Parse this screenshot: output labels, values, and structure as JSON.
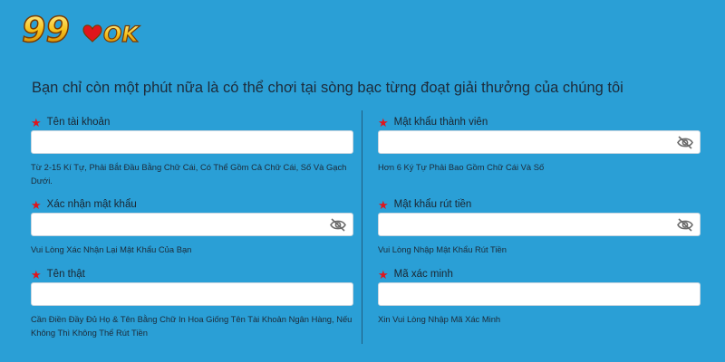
{
  "logo": {
    "text": "99OK"
  },
  "headline": "Bạn chỉ còn một phút nữa là có thể chơi tại sòng bạc từng đoạt giải thưởng của chúng tôi",
  "colors": {
    "background": "#2a9fd6",
    "required_star": "#e0151c",
    "input_bg": "#ffffff"
  },
  "form": {
    "left": [
      {
        "label": "Tên tài khoản",
        "value": "",
        "hint": "Từ 2-15 Kí Tự, Phải Bắt Đầu Bằng Chữ Cái, Có Thể Gồm Cả Chữ Cái, Số Và Gạch Dưới."
      },
      {
        "label": "Xác nhận mật khẩu",
        "value": "",
        "hint": "Vui Lòng Xác Nhận Lại Mật Khẩu Của Bạn",
        "icon": "eye-slash-icon"
      },
      {
        "label": "Tên thật",
        "value": "",
        "hint": "Cần Điền Đầy Đủ Họ & Tên Bằng Chữ In Hoa Giống Tên Tài Khoản Ngân Hàng, Nếu Không Thì Không Thể Rút Tiền"
      }
    ],
    "right": [
      {
        "label": "Mật khẩu thành viên",
        "value": "",
        "hint": "Hơn 6 Ký Tự Phải Bao Gồm Chữ Cái Và Số",
        "icon": "eye-slash-icon"
      },
      {
        "label": "Mật khẩu rút tiền",
        "value": "",
        "hint": "Vui Lòng Nhập Mật Khẩu Rút Tiền",
        "icon": "eye-slash-icon"
      },
      {
        "label": "Mã xác minh",
        "value": "",
        "hint": "Xin Vui Lòng Nhập Mã Xác Minh"
      }
    ]
  }
}
